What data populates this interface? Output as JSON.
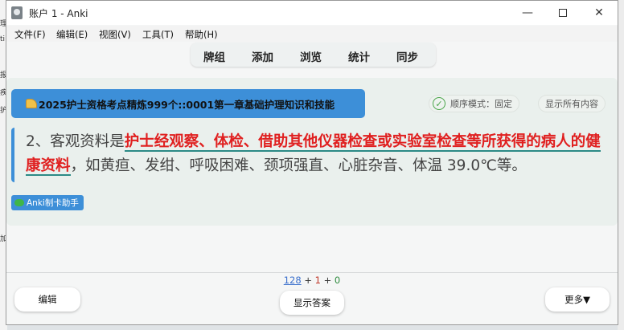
{
  "background_fragments": [
    "理",
    "ti",
    "报",
    "疾",
    "护",
    "加"
  ],
  "window": {
    "title": "账户 1 - Anki",
    "controls": {
      "minimize": "—",
      "close": "✕"
    }
  },
  "menu": [
    {
      "label": "文件(F)"
    },
    {
      "label": "编辑(E)"
    },
    {
      "label": "视图(V)"
    },
    {
      "label": "工具(T)"
    },
    {
      "label": "帮助(H)"
    }
  ],
  "toolbar": [
    {
      "label": "牌组"
    },
    {
      "label": "添加"
    },
    {
      "label": "浏览"
    },
    {
      "label": "统计"
    },
    {
      "label": "同步"
    }
  ],
  "card": {
    "deck_tag": "2025护士资格考点精炼999个::0001第一章基础护理知识和技能",
    "mode_label": "顺序模式：固定",
    "mode_check": "✓",
    "show_all_label": "显示所有内容",
    "text_prefix": "2、客观资料是",
    "text_highlight": "护士经观察、体检、借助其他仪器检查或实验室检查等所获得的病人的健康资料",
    "text_suffix": "，如黄疸、发绀、呼吸困难、颈项强直、心脏杂音、体温 39.0℃等。",
    "helper_badge": "Anki制卡助手"
  },
  "counts": {
    "new": "128",
    "plus1": " + ",
    "learning": "1",
    "plus2": " + ",
    "review": "0"
  },
  "buttons": {
    "edit": "编辑",
    "show_answer": "显示答案",
    "more": "更多▼"
  },
  "colors": {
    "accent_blue": "#3d8fd8",
    "highlight_red": "#e02020",
    "underline_teal": "#2c8a86",
    "new_count": "#3a6fcc",
    "learn_count": "#c0392b",
    "review_count": "#2e8b3e"
  }
}
